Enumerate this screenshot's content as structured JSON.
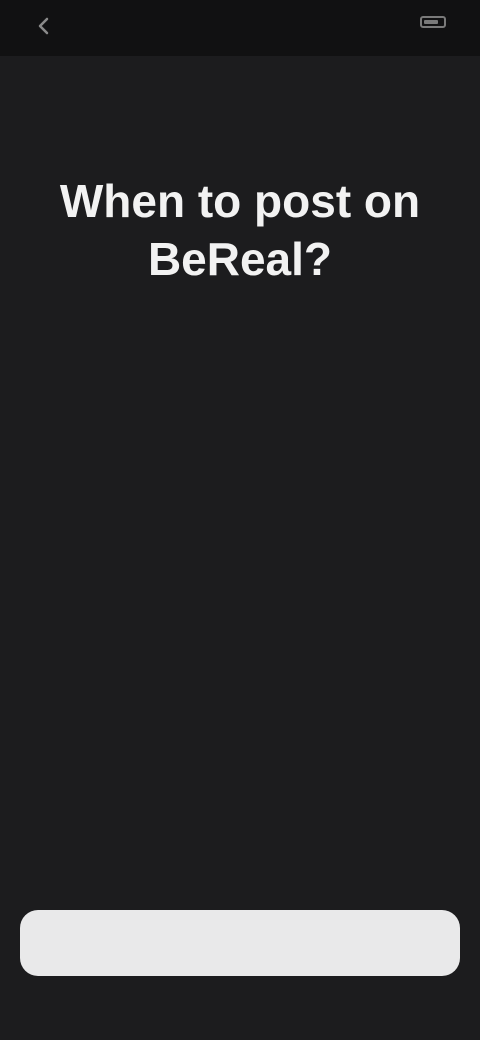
{
  "status_bar": {
    "back_label": "",
    "time": ""
  },
  "onboarding": {
    "title": "When to post on BeReal?",
    "body": "",
    "footnote": "",
    "cta_label": ""
  }
}
